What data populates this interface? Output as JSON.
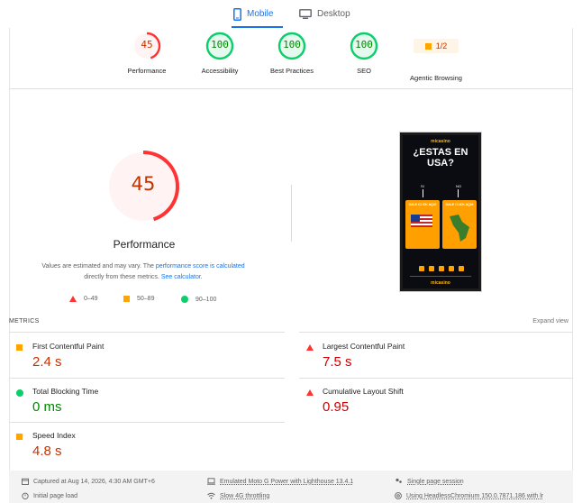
{
  "tabs": [
    {
      "label": "Mobile",
      "icon": "phone-icon",
      "active": true
    },
    {
      "label": "Desktop",
      "icon": "monitor-icon",
      "active": false
    }
  ],
  "categories": [
    {
      "score": "45",
      "label": "Performance",
      "status": "fail"
    },
    {
      "score": "100",
      "label": "Accessibility",
      "status": "pass"
    },
    {
      "score": "100",
      "label": "Best Practices",
      "status": "pass"
    },
    {
      "score": "100",
      "label": "SEO",
      "status": "pass"
    },
    {
      "score": "1/2",
      "label": "Agentic Browsing",
      "status": "average"
    }
  ],
  "performance": {
    "score": "45",
    "score_fraction": 0.45,
    "title": "Performance",
    "note_prefix": "Values are estimated and may vary. The ",
    "note_link1": "performance score is calculated",
    "note_middle": " directly from these metrics. ",
    "note_link2": "See calculator."
  },
  "legend": [
    {
      "range": "0–49",
      "shape": "triangle",
      "color": "#ff3333"
    },
    {
      "range": "50–89",
      "shape": "square",
      "color": "#ffa400"
    },
    {
      "range": "90–100",
      "shape": "circle",
      "color": "#0cce6b"
    }
  ],
  "screenshot": {
    "logo": "micasino",
    "headline_1": "¿ESTAS EN",
    "headline_2": "USA?",
    "choice_yes": "SI",
    "choice_no": "NO",
    "card_caption": "DALE CLICK AQUI",
    "footer_logo": "micasino"
  },
  "metrics_section": {
    "heading": "METRICS",
    "expand_label": "Expand view"
  },
  "metrics": [
    {
      "name": "First Contentful Paint",
      "value": "2.4 s",
      "status": "average"
    },
    {
      "name": "Largest Contentful Paint",
      "value": "7.5 s",
      "status": "fail"
    },
    {
      "name": "Total Blocking Time",
      "value": "0 ms",
      "status": "pass"
    },
    {
      "name": "Cumulative Layout Shift",
      "value": "0.95",
      "status": "fail"
    },
    {
      "name": "Speed Index",
      "value": "4.8 s",
      "status": "average"
    }
  ],
  "colors": {
    "pass": "#0cce6b",
    "pass_text": "#008800",
    "average": "#ffa400",
    "average_text": "#c33300",
    "fail": "#ff3333",
    "fail_text": "#cc0000",
    "accent": "#1a73e8"
  },
  "footer": {
    "captured": "Captured at Aug 14, 2026, 4:30 AM GMT+6",
    "initial_load": "Initial page load",
    "device": "Emulated Moto G Power with Lighthouse 13.4.1",
    "throttling": "Slow 4G throttling",
    "session": "Single page session",
    "browser": "Using HeadlessChromium 150.0.7871.186 with lr"
  }
}
